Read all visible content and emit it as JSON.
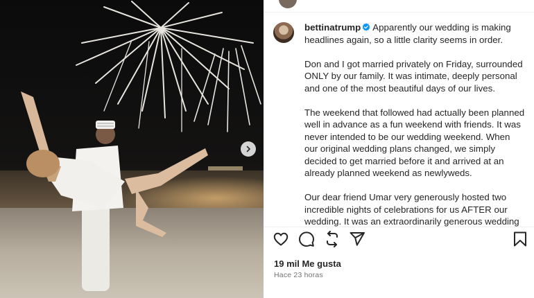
{
  "post": {
    "username": "bettinatrump",
    "verified": true,
    "caption_paragraphs": [
      "Apparently our wedding is making headlines again, so a little clarity seems in order.",
      "Don and I got married privately on Friday, surrounded ONLY by our family. It was intimate, deeply personal and one of the most beautiful days of our lives.",
      "The weekend that followed had actually been planned well in advance as a fun weekend with friends. It was never intended to be our wedding weekend. When our original wedding plans changed, we simply decided to get married before it and arrived at an already planned weekend as newlyweds.",
      "Our dear friend Umar very generously hosted two incredible nights of celebrations for us AFTER our wedding. It was an extraordinarily generous wedding gift from a friend, and something for which we were"
    ],
    "likes_label": "19 mil Me gusta",
    "time_ago": "Hace 23 horas"
  },
  "icons": {
    "verified": "verified-badge-icon",
    "like": "heart-icon",
    "comment": "comment-icon",
    "repost": "repost-icon",
    "share": "send-icon",
    "save": "bookmark-icon",
    "next": "chevron-right-icon"
  },
  "colors": {
    "verified_blue": "#0095f6",
    "text": "#262626",
    "muted": "#737373"
  }
}
